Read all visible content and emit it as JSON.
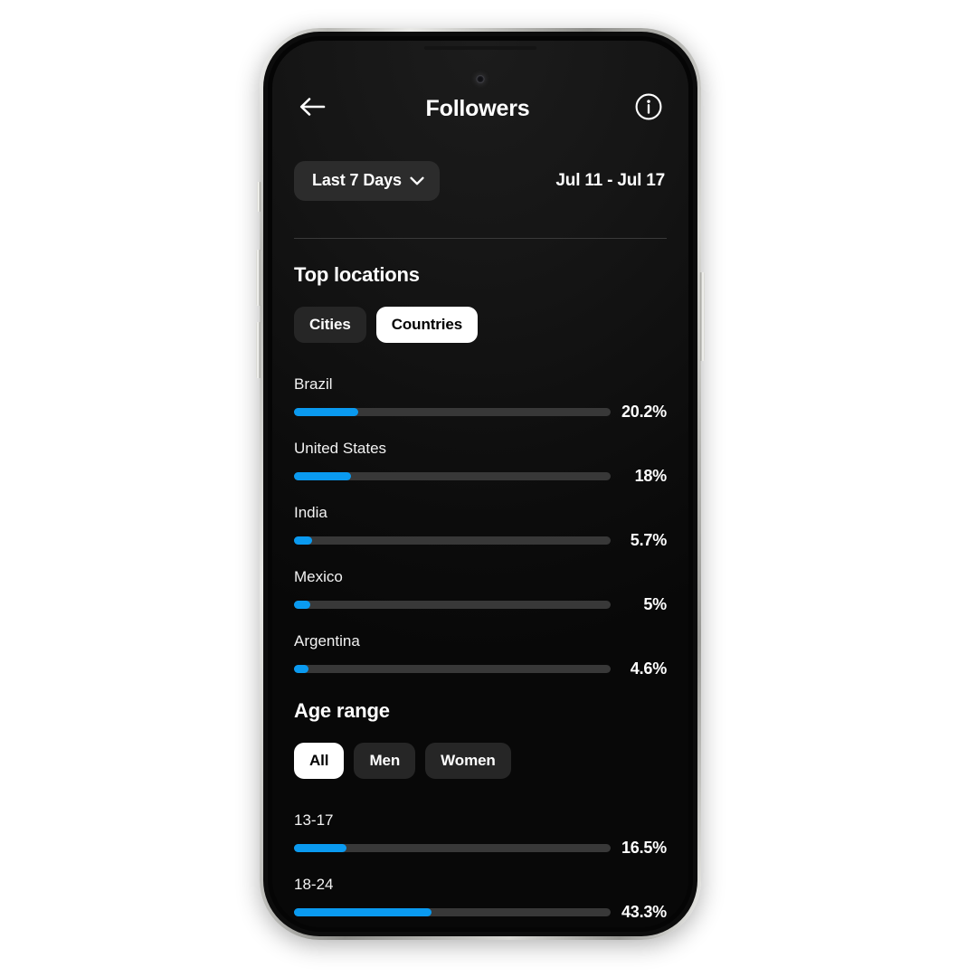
{
  "theme": {
    "accent": "#0a9af0",
    "track": "#383838",
    "screen_bg": "#0c0c0c",
    "pill_bg": "#262626",
    "pill_selected_bg": "#ffffff",
    "text": "#ffffff"
  },
  "header": {
    "back_icon": "arrow-left-icon",
    "title": "Followers",
    "info_icon": "info-circle-icon"
  },
  "date_bar": {
    "range_chip_label": "Last 7 Days",
    "caret_icon": "chevron-down-icon",
    "date_range": "Jul 11 - Jul 17"
  },
  "locations": {
    "title": "Top locations",
    "tabs": [
      {
        "label": "Cities",
        "selected": false
      },
      {
        "label": "Countries",
        "selected": true
      }
    ],
    "rows": [
      {
        "label": "Brazil",
        "value": "20.2%",
        "pct": 20.2
      },
      {
        "label": "United States",
        "value": "18%",
        "pct": 18.0
      },
      {
        "label": "India",
        "value": "5.7%",
        "pct": 5.7
      },
      {
        "label": "Mexico",
        "value": "5%",
        "pct": 5.0
      },
      {
        "label": "Argentina",
        "value": "4.6%",
        "pct": 4.6
      }
    ]
  },
  "age_range": {
    "title": "Age range",
    "tabs": [
      {
        "label": "All",
        "selected": true
      },
      {
        "label": "Men",
        "selected": false
      },
      {
        "label": "Women",
        "selected": false
      }
    ],
    "rows": [
      {
        "label": "13-17",
        "value": "16.5%",
        "pct": 16.5
      },
      {
        "label": "18-24",
        "value": "43.3%",
        "pct": 43.3
      }
    ]
  },
  "chart_data": [
    {
      "type": "bar",
      "title": "Top locations",
      "orientation": "horizontal",
      "categories": [
        "Brazil",
        "United States",
        "India",
        "Mexico",
        "Argentina"
      ],
      "values": [
        20.2,
        18.0,
        5.7,
        5.0,
        4.6
      ],
      "value_labels": [
        "20.2%",
        "18%",
        "5.7%",
        "5%",
        "4.6%"
      ],
      "xlabel": "",
      "ylabel": "",
      "xlim": [
        0,
        100
      ],
      "unit": "percent",
      "grid": false,
      "legend": null,
      "series_color": "#0a9af0",
      "active_tab": "Countries"
    },
    {
      "type": "bar",
      "title": "Age range",
      "orientation": "horizontal",
      "categories": [
        "13-17",
        "18-24"
      ],
      "values": [
        16.5,
        43.3
      ],
      "value_labels": [
        "16.5%",
        "43.3%"
      ],
      "xlabel": "",
      "ylabel": "",
      "xlim": [
        0,
        100
      ],
      "unit": "percent",
      "grid": false,
      "legend": null,
      "series_color": "#0a9af0",
      "active_tab": "All",
      "note": "list continues below the visible viewport"
    }
  ]
}
